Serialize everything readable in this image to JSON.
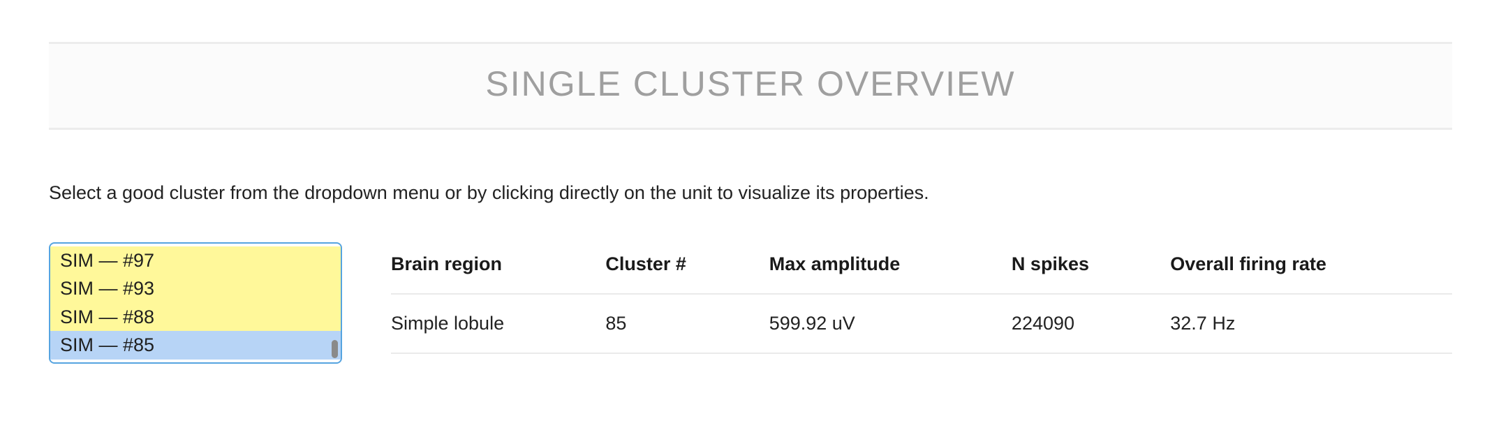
{
  "banner": {
    "title": "SINGLE CLUSTER OVERVIEW"
  },
  "instruction": "Select a good cluster from the dropdown menu or by clicking directly on the unit to visualize its properties.",
  "cluster_list": {
    "options": [
      {
        "label": "SIM — #97",
        "highlight": "yellow"
      },
      {
        "label": "SIM — #93",
        "highlight": "yellow"
      },
      {
        "label": "SIM — #88",
        "highlight": "yellow"
      },
      {
        "label": "SIM — #85",
        "highlight": "blue"
      }
    ]
  },
  "properties": {
    "headers": {
      "brain_region": "Brain region",
      "cluster_num": "Cluster #",
      "max_amplitude": "Max amplitude",
      "n_spikes": "N spikes",
      "firing_rate": "Overall firing rate"
    },
    "row": {
      "brain_region": "Simple lobule",
      "cluster_num": "85",
      "max_amplitude": "599.92 uV",
      "n_spikes": "224090",
      "firing_rate": "32.7 Hz"
    }
  }
}
